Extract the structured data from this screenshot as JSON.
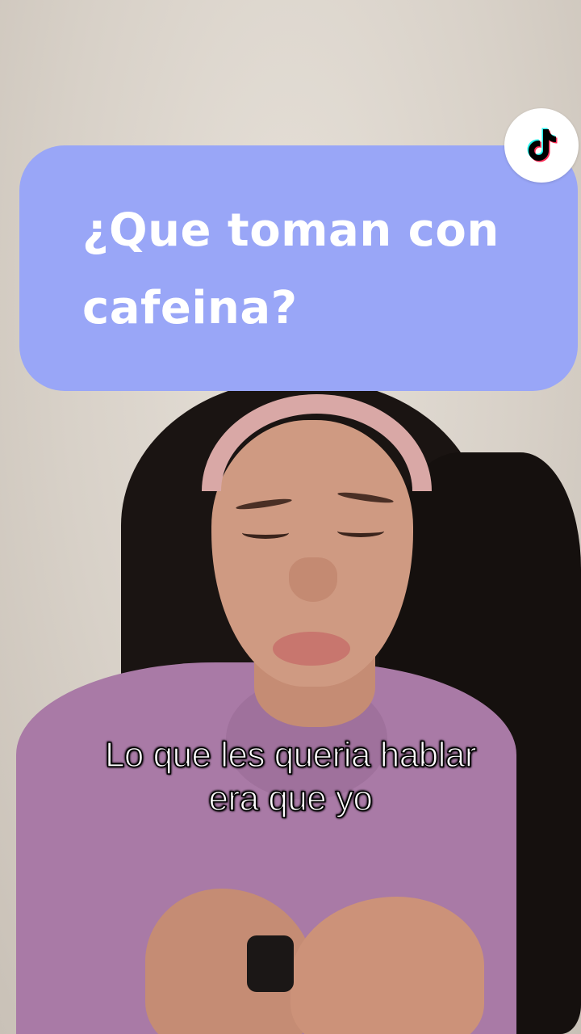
{
  "question_card": {
    "line1": "¿Que toman con",
    "line2": "cafeina?",
    "background_color": "#99a6f7"
  },
  "caption": {
    "line1": "Lo que les queria hablar",
    "line2": "era que yo"
  },
  "badge": {
    "icon": "tiktok-logo-icon"
  },
  "scene": {
    "shirt_color": "#a97aa6",
    "headband_color": "#d9a8a6",
    "wall_color": "#d9d3cb"
  }
}
